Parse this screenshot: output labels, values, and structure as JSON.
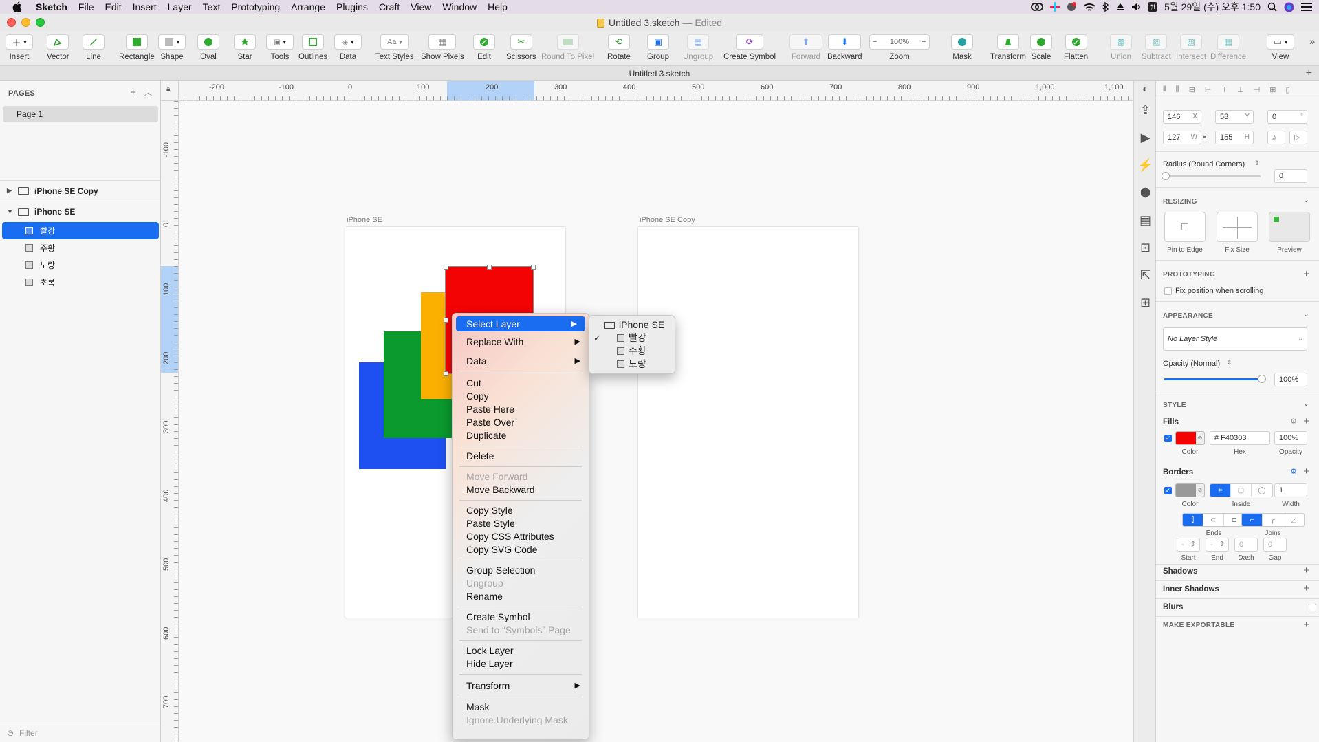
{
  "menubar": {
    "app_name": "Sketch",
    "items": [
      "File",
      "Edit",
      "Insert",
      "Layer",
      "Text",
      "Prototyping",
      "Arrange",
      "Plugins",
      "Craft",
      "View",
      "Window",
      "Help"
    ],
    "clock": "5월 29일 (수) 오후 1:50"
  },
  "window": {
    "title": "Untitled 3.sketch",
    "edited": "— Edited",
    "doc_strip": "Untitled 3.sketch"
  },
  "toolbar": {
    "insert": "Insert",
    "vector": "Vector",
    "line": "Line",
    "rectangle": "Rectangle",
    "shape": "Shape",
    "oval": "Oval",
    "star": "Star",
    "tools": "Tools",
    "outlines": "Outlines",
    "data": "Data",
    "text_styles": "Text Styles",
    "text_styles_btn": "Aa",
    "show_pixels": "Show Pixels",
    "edit": "Edit",
    "scissors": "Scissors",
    "round_to_pixel": "Round To Pixel",
    "rotate": "Rotate",
    "group": "Group",
    "ungroup": "Ungroup",
    "create_symbol": "Create Symbol",
    "forward": "Forward",
    "backward": "Backward",
    "zoom": "Zoom",
    "zoom_value": "100%",
    "mask": "Mask",
    "transform": "Transform",
    "scale": "Scale",
    "flatten": "Flatten",
    "union": "Union",
    "subtract": "Subtract",
    "intersect": "Intersect",
    "difference": "Difference",
    "view": "View"
  },
  "pages": {
    "header": "PAGES",
    "items": [
      "Page 1"
    ]
  },
  "layers": {
    "artboards": [
      "iPhone SE Copy",
      "iPhone SE"
    ],
    "children": [
      "빨강",
      "주황",
      "노랑",
      "초록"
    ],
    "filter_placeholder": "Filter"
  },
  "ruler": {
    "top": [
      "-200",
      "-100",
      "0",
      "100",
      "200",
      "300",
      "400",
      "500",
      "600",
      "700",
      "800",
      "900",
      "1,000",
      "1,100"
    ],
    "left": [
      "-100",
      "0",
      "100",
      "200",
      "300",
      "400",
      "500",
      "600",
      "700"
    ]
  },
  "canvas": {
    "artboard1_label": "iPhone SE",
    "artboard2_label": "iPhone SE Copy",
    "colors": {
      "red": "#F40303",
      "orange": "#FBB000",
      "green": "#0A9A2E",
      "blue": "#1E4FF0"
    }
  },
  "context_menu": {
    "select_layer": "Select Layer",
    "replace_with": "Replace With",
    "data": "Data",
    "cut": "Cut",
    "copy": "Copy",
    "paste_here": "Paste Here",
    "paste_over": "Paste Over",
    "duplicate": "Duplicate",
    "delete": "Delete",
    "move_forward": "Move Forward",
    "move_backward": "Move Backward",
    "copy_style": "Copy Style",
    "paste_style": "Paste Style",
    "copy_css": "Copy CSS Attributes",
    "copy_svg": "Copy SVG Code",
    "group_selection": "Group Selection",
    "ungroup": "Ungroup",
    "rename": "Rename",
    "create_symbol": "Create Symbol",
    "send_to_symbols": "Send to “Symbols” Page",
    "lock_layer": "Lock Layer",
    "hide_layer": "Hide Layer",
    "transform": "Transform",
    "mask": "Mask",
    "ignore_mask": "Ignore Underlying Mask"
  },
  "submenu": {
    "artboard": "iPhone SE",
    "layers": [
      "빨강",
      "주황",
      "노랑"
    ],
    "checked": "빨강"
  },
  "inspector": {
    "x": "146",
    "x_unit": "X",
    "y": "58",
    "y_unit": "Y",
    "rotation": "0",
    "rotation_unit": "°",
    "w": "127",
    "w_unit": "W",
    "h": "155",
    "h_unit": "H",
    "radius_label": "Radius (Round Corners)",
    "radius_value": "0",
    "resizing": "RESIZING",
    "pin_to_edge": "Pin to Edge",
    "fix_size": "Fix Size",
    "preview": "Preview",
    "prototyping": "PROTOTYPING",
    "fix_position": "Fix position when scrolling",
    "appearance": "APPEARANCE",
    "layer_style": "No Layer Style",
    "opacity_label": "Opacity (Normal)",
    "opacity_value": "100%",
    "opacity_fraction": 1.0,
    "style": "STYLE",
    "fills": "Fills",
    "fill_hex": "# F40303",
    "fill_opacity": "100%",
    "fill_color_cap": "Color",
    "fill_hex_cap": "Hex",
    "fill_opacity_cap": "Opacity",
    "borders": "Borders",
    "border_width": "1",
    "border_color_cap": "Color",
    "border_pos_cap": "Inside",
    "border_width_cap": "Width",
    "ends": "Ends",
    "joins": "Joins",
    "start": "Start",
    "end": "End",
    "dash": "Dash",
    "gap": "Gap",
    "dash_value": "0",
    "gap_value": "0",
    "start_value": "-",
    "end_value": "-",
    "shadows": "Shadows",
    "inner_shadows": "Inner Shadows",
    "blurs": "Blurs",
    "make_exportable": "MAKE EXPORTABLE"
  }
}
